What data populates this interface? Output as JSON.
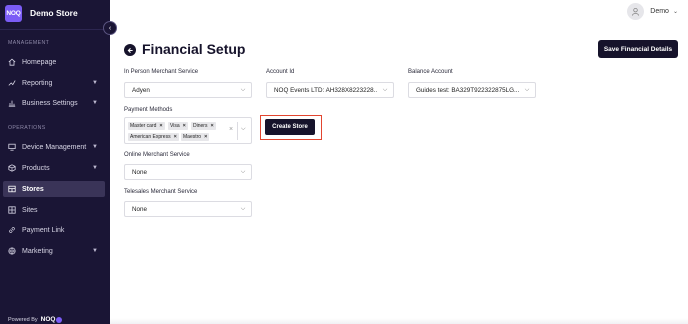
{
  "app": {
    "logo_text": "NOQ",
    "store_name": "Demo Store",
    "powered_by": "Powered By",
    "powered_brand": "NOQ"
  },
  "sidebar": {
    "sections": [
      {
        "label": "MANAGEMENT"
      },
      {
        "label": "OPERATIONS"
      }
    ],
    "items": [
      {
        "label": "Homepage",
        "icon": "home-icon",
        "has_chevron": false,
        "active": false
      },
      {
        "label": "Reporting",
        "icon": "chart-icon",
        "has_chevron": true,
        "active": false
      },
      {
        "label": "Business Settings",
        "icon": "bar-chart-icon",
        "has_chevron": true,
        "active": false
      },
      {
        "label": "Device Management",
        "icon": "monitor-icon",
        "has_chevron": true,
        "active": false
      },
      {
        "label": "Products",
        "icon": "box-icon",
        "has_chevron": true,
        "active": false
      },
      {
        "label": "Stores",
        "icon": "store-icon",
        "has_chevron": false,
        "active": true
      },
      {
        "label": "Sites",
        "icon": "grid-icon",
        "has_chevron": false,
        "active": false
      },
      {
        "label": "Payment Link",
        "icon": "link-icon",
        "has_chevron": false,
        "active": false
      },
      {
        "label": "Marketing",
        "icon": "globe-icon",
        "has_chevron": true,
        "active": false
      }
    ]
  },
  "user": {
    "name": "Demo"
  },
  "page": {
    "title": "Financial Setup",
    "save_label": "Save Financial Details"
  },
  "form": {
    "in_person": {
      "label": "In Person Merchant Service",
      "value": "Adyen"
    },
    "account_id": {
      "label": "Account Id",
      "value": "NOQ Events LTD: AH328X8223228..."
    },
    "balance_account": {
      "label": "Balance Account",
      "value": "Guides test: BA329T922322875LG..."
    },
    "payment_methods": {
      "label": "Payment Methods",
      "tags": [
        "Master card",
        "Visa",
        "Diners",
        "American Express",
        "Maestro"
      ]
    },
    "create_store_label": "Create Store",
    "online": {
      "label": "Online Merchant Service",
      "value": "None"
    },
    "telesales": {
      "label": "Telesales Merchant Service",
      "value": "None"
    }
  },
  "colors": {
    "sidebar_bg": "#1a1535",
    "primary_button": "#16132b",
    "brand_accent": "#7b5cf6",
    "highlight_border": "#e2452f"
  }
}
